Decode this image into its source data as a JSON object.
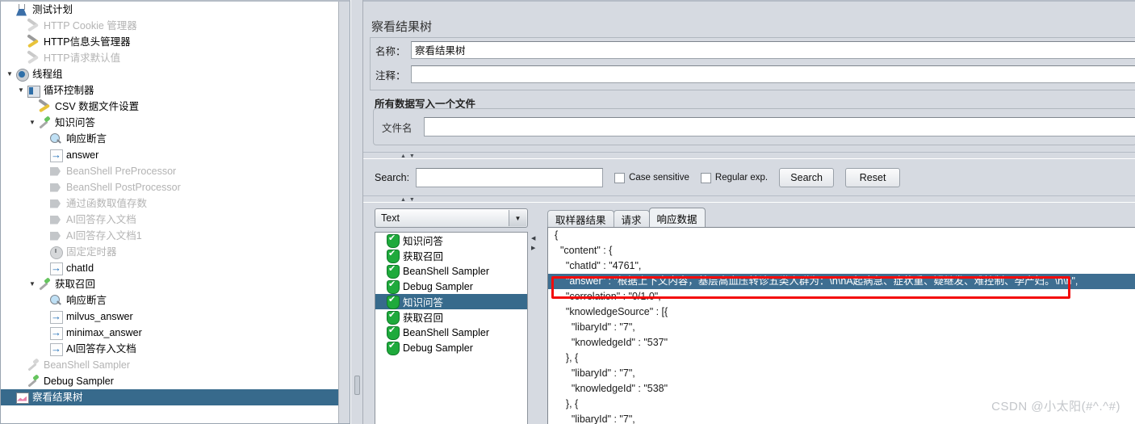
{
  "tree": {
    "items": [
      {
        "label": "测试计划",
        "indent": 0,
        "icon": "flask-icon",
        "toggle": "",
        "dim": false,
        "selected": false
      },
      {
        "label": "HTTP Cookie 管理器",
        "indent": 14,
        "icon": "wrench-icon",
        "toggle": "",
        "dim": true,
        "selected": false
      },
      {
        "label": "HTTP信息头管理器",
        "indent": 14,
        "icon": "wrench-icon",
        "toggle": "",
        "dim": false,
        "selected": false
      },
      {
        "label": "HTTP请求默认值",
        "indent": 14,
        "icon": "wrench-icon",
        "toggle": "",
        "dim": true,
        "selected": false
      },
      {
        "label": "线程组",
        "indent": 0,
        "icon": "gear-icon",
        "toggle": "▼",
        "dim": false,
        "selected": false
      },
      {
        "label": "循环控制器",
        "indent": 14,
        "icon": "loop-controller-icon",
        "toggle": "▼",
        "dim": false,
        "selected": false
      },
      {
        "label": "CSV 数据文件设置",
        "indent": 28,
        "icon": "wrench-icon",
        "toggle": "",
        "dim": false,
        "selected": false
      },
      {
        "label": "知识问答",
        "indent": 28,
        "icon": "pipette-icon",
        "toggle": "▼",
        "dim": false,
        "selected": false
      },
      {
        "label": "响应断言",
        "indent": 42,
        "icon": "magnifier-icon",
        "toggle": "",
        "dim": false,
        "selected": false
      },
      {
        "label": "answer",
        "indent": 42,
        "icon": "post-processor-arrow-icon",
        "toggle": "",
        "dim": false,
        "selected": false
      },
      {
        "label": "BeanShell PreProcessor",
        "indent": 42,
        "icon": "processor-icon",
        "toggle": "",
        "dim": true,
        "selected": false
      },
      {
        "label": "BeanShell PostProcessor",
        "indent": 42,
        "icon": "processor-icon",
        "toggle": "",
        "dim": true,
        "selected": false
      },
      {
        "label": "通过函数取值存数",
        "indent": 42,
        "icon": "processor-icon",
        "toggle": "",
        "dim": true,
        "selected": false
      },
      {
        "label": "AI回答存入文档",
        "indent": 42,
        "icon": "processor-icon",
        "toggle": "",
        "dim": true,
        "selected": false
      },
      {
        "label": "AI回答存入文档1",
        "indent": 42,
        "icon": "processor-icon",
        "toggle": "",
        "dim": true,
        "selected": false
      },
      {
        "label": "固定定时器",
        "indent": 42,
        "icon": "timer-icon",
        "toggle": "",
        "dim": true,
        "selected": false
      },
      {
        "label": "chatId",
        "indent": 42,
        "icon": "post-processor-arrow-icon",
        "toggle": "",
        "dim": false,
        "selected": false
      },
      {
        "label": "获取召回",
        "indent": 28,
        "icon": "pipette-icon",
        "toggle": "▼",
        "dim": false,
        "selected": false
      },
      {
        "label": "响应断言",
        "indent": 42,
        "icon": "magnifier-icon",
        "toggle": "",
        "dim": false,
        "selected": false
      },
      {
        "label": "milvus_answer",
        "indent": 42,
        "icon": "post-processor-arrow-icon",
        "toggle": "",
        "dim": false,
        "selected": false
      },
      {
        "label": "minimax_answer",
        "indent": 42,
        "icon": "post-processor-arrow-icon",
        "toggle": "",
        "dim": false,
        "selected": false
      },
      {
        "label": "AI回答存入文档",
        "indent": 42,
        "icon": "post-processor-arrow-icon",
        "toggle": "",
        "dim": false,
        "selected": false
      },
      {
        "label": "BeanShell Sampler",
        "indent": 14,
        "icon": "pipette-icon",
        "toggle": "",
        "dim": true,
        "selected": false
      },
      {
        "label": "Debug Sampler",
        "indent": 14,
        "icon": "pipette-icon",
        "toggle": "",
        "dim": false,
        "selected": false
      },
      {
        "label": "察看结果树",
        "indent": 0,
        "icon": "view-results-tree-icon",
        "toggle": "",
        "dim": false,
        "selected": true
      }
    ]
  },
  "panel": {
    "title": "察看结果树",
    "name_label": "名称：",
    "name_value": "察看结果树",
    "comment_label": "注释：",
    "comment_value": "",
    "file_group_title": "所有数据写入一个文件",
    "file_label": "文件名",
    "file_value": ""
  },
  "search": {
    "label": "Search:",
    "value": "",
    "case_sensitive_label": "Case sensitive",
    "case_sensitive_checked": false,
    "regular_exp_label": "Regular exp.",
    "regular_exp_checked": false,
    "search_button": "Search",
    "reset_button": "Reset"
  },
  "renderer": {
    "selected": "Text"
  },
  "results": {
    "items": [
      {
        "label": "知识问答",
        "status": "success",
        "selected": false
      },
      {
        "label": "获取召回",
        "status": "success",
        "selected": false
      },
      {
        "label": "BeanShell Sampler",
        "status": "success",
        "selected": false
      },
      {
        "label": "Debug Sampler",
        "status": "success",
        "selected": false
      },
      {
        "label": "知识问答",
        "status": "success",
        "selected": true
      },
      {
        "label": "获取召回",
        "status": "success",
        "selected": false
      },
      {
        "label": "BeanShell Sampler",
        "status": "success",
        "selected": false
      },
      {
        "label": "Debug Sampler",
        "status": "success",
        "selected": false
      }
    ]
  },
  "tabs": [
    {
      "label": "取样器结果",
      "active": false
    },
    {
      "label": "请求",
      "active": false
    },
    {
      "label": "响应数据",
      "active": true
    }
  ],
  "response": {
    "lines": [
      {
        "text": "{",
        "highlight": false
      },
      {
        "text": "  \"content\" : {",
        "highlight": false
      },
      {
        "text": "    \"chatId\" : \"4761\",",
        "highlight": false
      },
      {
        "text": "    \"answer\" : \"根据上下文内容，基层高血压转诊五类人群为：\\n\\nA起病急、症状重、疑继发、难控制、孕产妇。\\n\\n\",",
        "highlight": true
      },
      {
        "text": "    \"correlation\" : \"0/1.0\",",
        "highlight": false
      },
      {
        "text": "    \"knowledgeSource\" : [{",
        "highlight": false
      },
      {
        "text": "      \"libaryId\" : \"7\",",
        "highlight": false
      },
      {
        "text": "      \"knowledgeId\" : \"537\"",
        "highlight": false
      },
      {
        "text": "    }, {",
        "highlight": false
      },
      {
        "text": "      \"libaryId\" : \"7\",",
        "highlight": false
      },
      {
        "text": "      \"knowledgeId\" : \"538\"",
        "highlight": false
      },
      {
        "text": "    }, {",
        "highlight": false
      },
      {
        "text": "      \"libaryId\" : \"7\",",
        "highlight": false
      }
    ]
  },
  "watermark": "CSDN @小太阳(#^.^#)",
  "colors": {
    "selection_blue": "#376a8c",
    "panel_gray": "#d6dae1",
    "highlight_box_red": "#f30b0b",
    "status_green": "#1faa3c"
  }
}
